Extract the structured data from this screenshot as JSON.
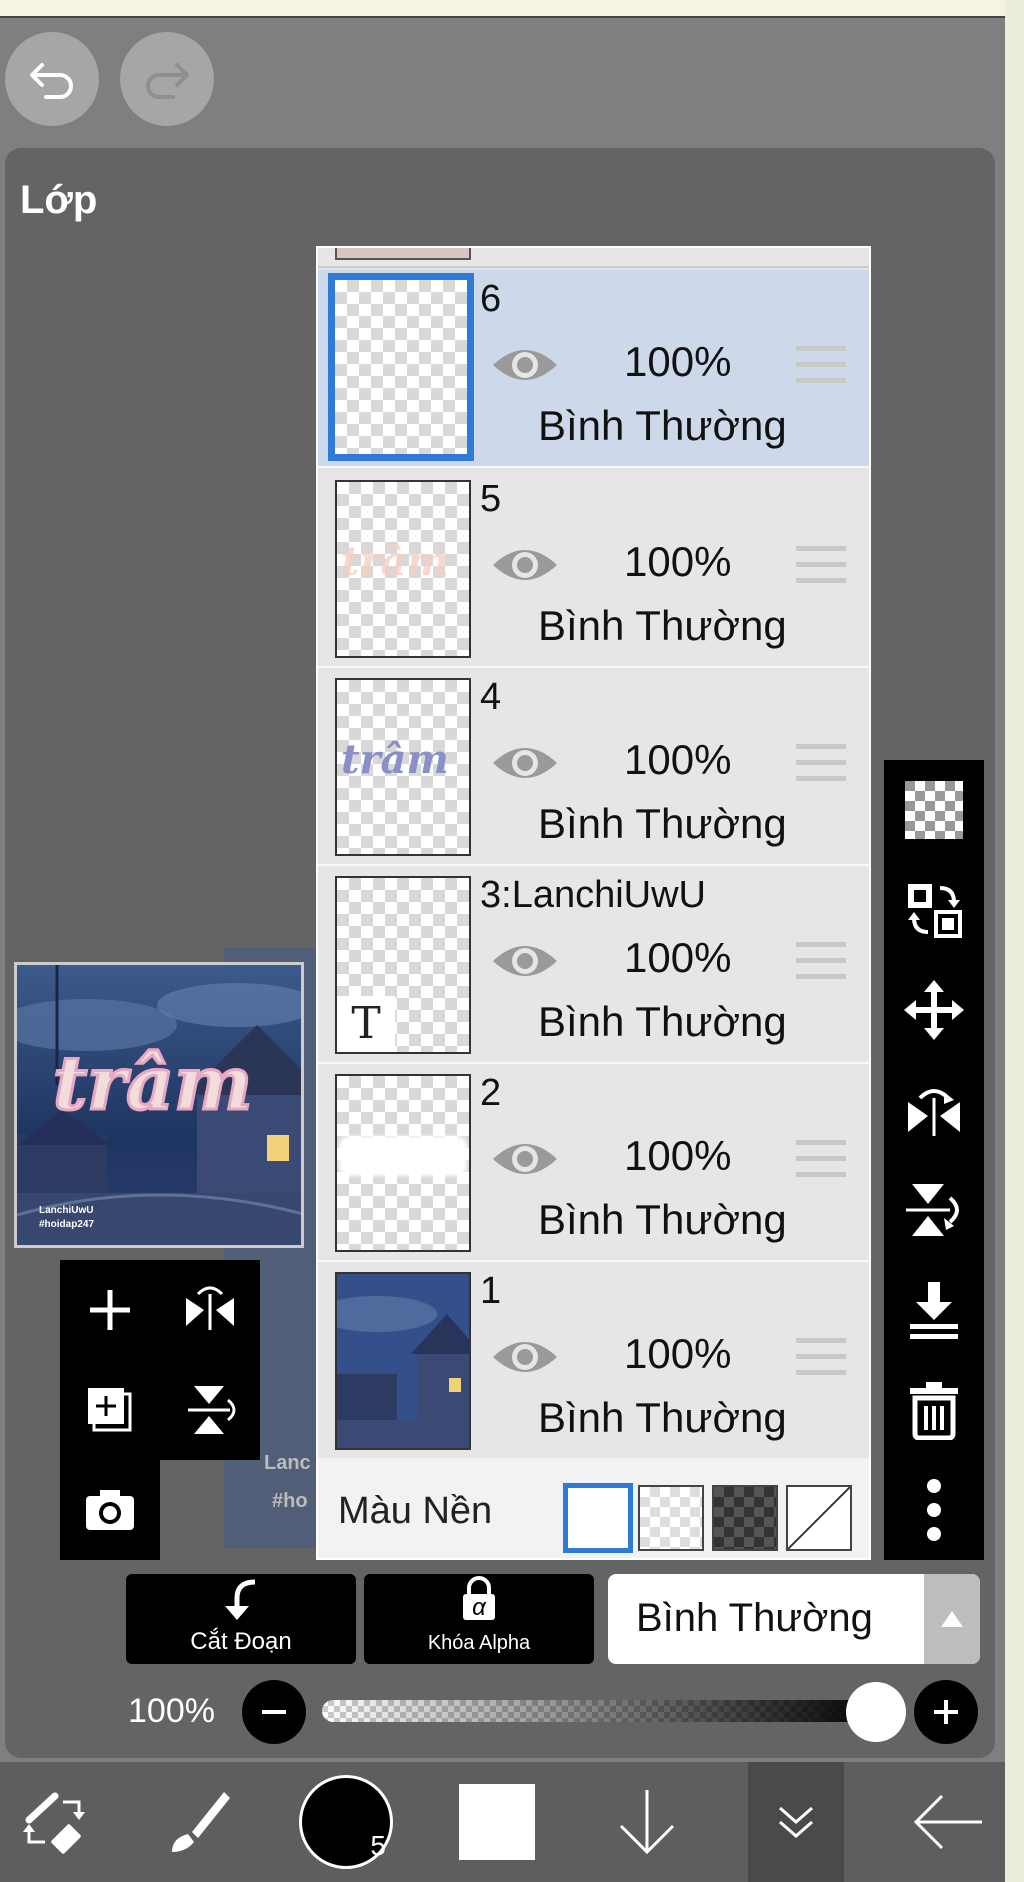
{
  "panel": {
    "title": "Lớp"
  },
  "layers": [
    {
      "name": "6",
      "opacity": "100%",
      "blend": "Bình Thường",
      "selected": true
    },
    {
      "name": "5",
      "opacity": "100%",
      "blend": "Bình Thường",
      "selected": false
    },
    {
      "name": "4",
      "opacity": "100%",
      "blend": "Bình Thường",
      "selected": false
    },
    {
      "name": "3:LanchiUwU",
      "opacity": "100%",
      "blend": "Bình Thường",
      "selected": false
    },
    {
      "name": "2",
      "opacity": "100%",
      "blend": "Bình Thường",
      "selected": false
    },
    {
      "name": "1",
      "opacity": "100%",
      "blend": "Bình Thường",
      "selected": false
    }
  ],
  "background_color": {
    "label": "Màu Nền"
  },
  "thumb_text": {
    "layer4": "trâm",
    "layer5": "trâm",
    "layer3": "T"
  },
  "preview": {
    "title": "trâm",
    "line1": "LanchiUwU",
    "line2": "#hoidap247",
    "behind1": "Lanc",
    "behind2": "#ho"
  },
  "actions": {
    "clipping_label": "Cắt Đoạn",
    "alpha_lock_label": "Khóa Alpha",
    "alpha_symbol": "α"
  },
  "blend_select": {
    "value": "Bình Thường"
  },
  "opacity_slider": {
    "label": "100%",
    "value": 1.0
  },
  "bottom_bar": {
    "brush_size": "5"
  },
  "colors": {
    "accent": "#2f7ad6",
    "selected_row": "#cdd9ea",
    "panel": "#646464",
    "toolbar": "#000000"
  }
}
